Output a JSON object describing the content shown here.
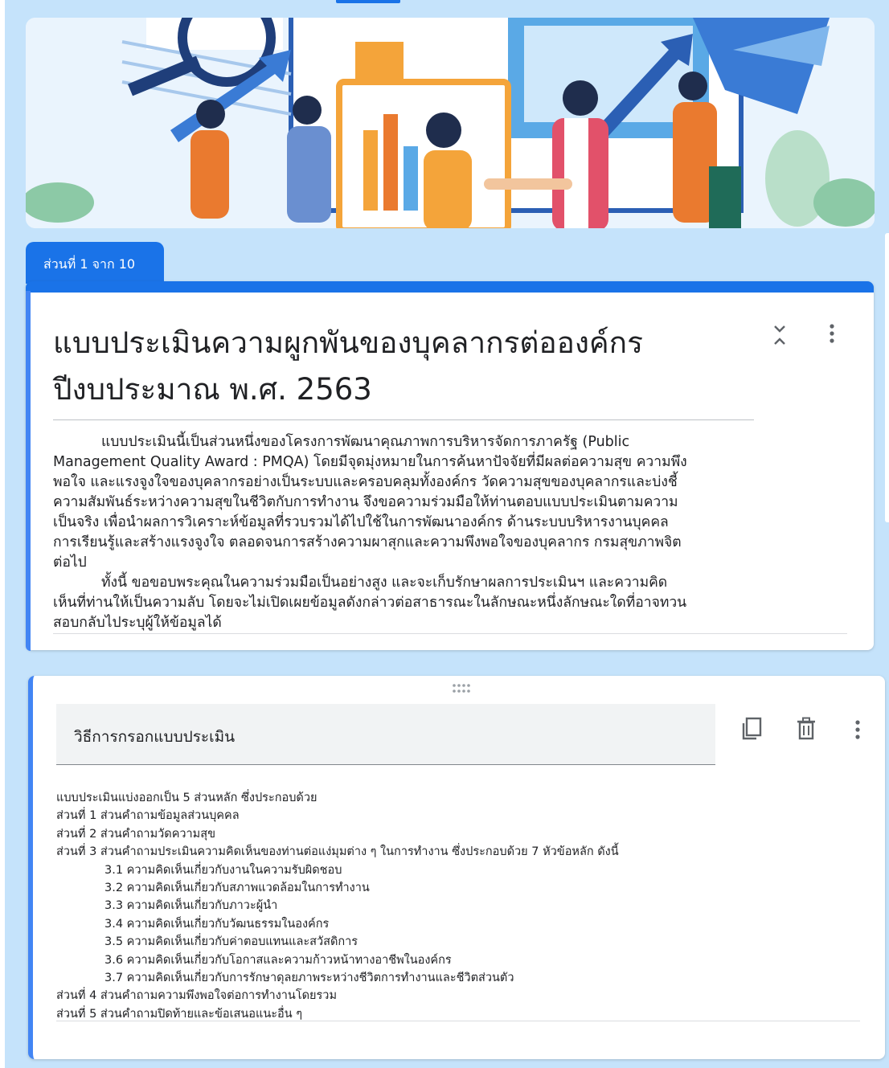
{
  "header": {
    "banner_image": "people-business-collaboration-illustration"
  },
  "section": {
    "tab_label": "ส่วนที่ 1 จาก 10"
  },
  "form": {
    "title_line1": "แบบประเมินความผูกพันของบุคลากรต่อองค์กร",
    "title_line2": "ปีงบประมาณ พ.ศ. 2563",
    "description_p1": "แบบประเมินนี้เป็นส่วนหนึ่งของโครงการพัฒนาคุณภาพการบริหารจัดการภาครัฐ (Public Management Quality Award : PMQA) โดยมีจุดมุ่งหมายในการค้นหาปัจจัยที่มีผลต่อความสุข ความพึงพอใจ และแรงจูงใจของบุคลากรอย่างเป็นระบบและครอบคลุมทั้งองค์กร วัดความสุขของบุคลากรและบ่งชี้ความสัมพันธ์ระหว่างความสุขในชีวิตกับการทำงาน จึงขอความร่วมมือให้ท่านตอบแบบประเมินตามความเป็นจริง เพื่อนำผลการวิเคราะห์ข้อมูลที่รวบรวมได้ไปใช้ในการพัฒนาองค์กร ด้านระบบบริหารงานบุคคล การเรียนรู้และสร้างแรงจูงใจ ตลอดจนการสร้างความผาสุกและความพึงพอใจของบุคลากร กรมสุขภาพจิตต่อไป",
    "description_p2": "ทั้งนี้ ขอขอบพระคุณในความร่วมมือเป็นอย่างสูง และจะเก็บรักษาผลการประเมินฯ และความคิดเห็นที่ท่านให้เป็นความลับ โดยจะไม่เปิดเผยข้อมูลดังกล่าวต่อสาธารณะในลักษณะหนึ่งลักษณะใดที่อาจทวนสอบกลับไประบุผู้ให้ข้อมูลได้"
  },
  "question": {
    "title": "วิธีการกรอกแบบประเมิน",
    "lines": [
      {
        "text": "แบบประเมินแบ่งออกเป็น 5 ส่วนหลัก ซึ่งประกอบด้วย",
        "indent": false
      },
      {
        "text": "ส่วนที่ 1 ส่วนคำถามข้อมูลส่วนบุคคล",
        "indent": false
      },
      {
        "text": "ส่วนที่ 2 ส่วนคำถามวัดความสุข",
        "indent": false
      },
      {
        "text": "ส่วนที่ 3 ส่วนคำถามประเมินความคิดเห็นของท่านต่อแง่มุมต่าง ๆ ในการทำงาน ซึ่งประกอบด้วย 7 หัวข้อหลัก ดังนี้",
        "indent": false
      },
      {
        "text": "3.1 ความคิดเห็นเกี่ยวกับงานในความรับผิดชอบ",
        "indent": true
      },
      {
        "text": "3.2 ความคิดเห็นเกี่ยวกับสภาพแวดล้อมในการทำงาน",
        "indent": true
      },
      {
        "text": "3.3 ความคิดเห็นเกี่ยวกับภาวะผู้นำ",
        "indent": true
      },
      {
        "text": "3.4 ความคิดเห็นเกี่ยวกับวัฒนธรรมในองค์กร",
        "indent": true
      },
      {
        "text": "3.5 ความคิดเห็นเกี่ยวกับค่าตอบแทนและสวัสดิการ",
        "indent": true
      },
      {
        "text": "3.6 ความคิดเห็นเกี่ยวกับโอกาสและความก้าวหน้าทางอาชีพในองค์กร",
        "indent": true
      },
      {
        "text": "3.7 ความคิดเห็นเกี่ยวกับการรักษาดุลยภาพระหว่างชีวิตการทำงานและชีวิตส่วนตัว",
        "indent": true
      },
      {
        "text": "ส่วนที่ 4 ส่วนคำถามความพึงพอใจต่อการทำงานโดยรวม",
        "indent": false
      },
      {
        "text": "ส่วนที่ 5 ส่วนคำถามปิดท้ายและข้อเสนอแนะอื่น ๆ",
        "indent": false
      }
    ]
  },
  "icons": {
    "collapse": "collapse-icon",
    "more": "more-vert-icon",
    "duplicate": "copy-icon",
    "delete": "trash-icon",
    "drag": "drag-handle-icon"
  },
  "colors": {
    "accent": "#1a73e8",
    "accent_light": "#4285f4",
    "background": "#c5e3fb"
  }
}
